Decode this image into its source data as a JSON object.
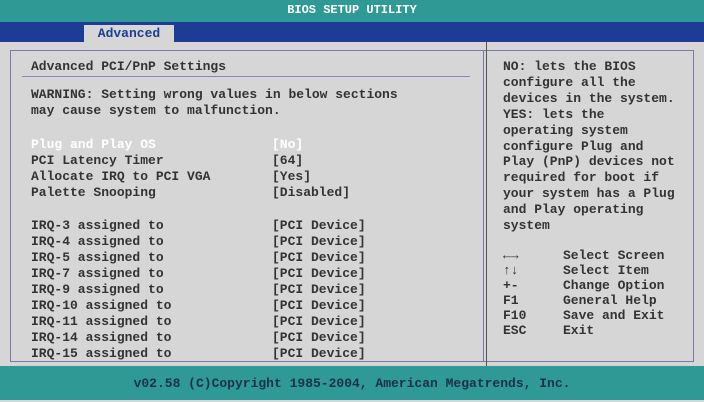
{
  "title": "BIOS SETUP UTILITY",
  "tabs": [
    {
      "label": "Advanced",
      "active": true
    }
  ],
  "section": {
    "title": "Advanced PCI/PnP Settings",
    "warning": "WARNING: Setting wrong values in below sections\nmay cause system to malfunction."
  },
  "settings": [
    {
      "label": "Plug and Play OS",
      "value": "[No]",
      "selected": true
    },
    {
      "label": "PCI Latency Timer",
      "value": "[64]",
      "selected": false
    },
    {
      "label": "Allocate IRQ to PCI VGA",
      "value": "[Yes]",
      "selected": false
    },
    {
      "label": "Palette Snooping",
      "value": "[Disabled]",
      "selected": false
    }
  ],
  "irqs": [
    {
      "label": "IRQ-3 assigned to",
      "value": "[PCI Device]"
    },
    {
      "label": "IRQ-4 assigned to",
      "value": "[PCI Device]"
    },
    {
      "label": "IRQ-5 assigned to",
      "value": "[PCI Device]"
    },
    {
      "label": "IRQ-7 assigned to",
      "value": "[PCI Device]"
    },
    {
      "label": "IRQ-9 assigned to",
      "value": "[PCI Device]"
    },
    {
      "label": "IRQ-10 assigned to",
      "value": "[PCI Device]"
    },
    {
      "label": "IRQ-11 assigned to",
      "value": "[PCI Device]"
    },
    {
      "label": "IRQ-14 assigned to",
      "value": "[PCI Device]"
    },
    {
      "label": "IRQ-15 assigned to",
      "value": "[PCI Device]"
    }
  ],
  "help": {
    "text": "NO: lets the BIOS\nconfigure all the\ndevices in the system.\nYES: lets the\noperating system\nconfigure Plug and\nPlay (PnP) devices not\nrequired for boot if\nyour system has a Plug\nand Play operating\nsystem",
    "keys": [
      {
        "key": "←→",
        "desc": "Select Screen"
      },
      {
        "key": "↑↓",
        "desc": "Select Item"
      },
      {
        "key": "+-",
        "desc": "Change Option"
      },
      {
        "key": "F1",
        "desc": "General Help"
      },
      {
        "key": "F10",
        "desc": "Save and Exit"
      },
      {
        "key": "ESC",
        "desc": "Exit"
      }
    ]
  },
  "footer": "v02.58 (C)Copyright 1985-2004, American Megatrends, Inc.",
  "colors": {
    "title_bar": "#2f9a95",
    "tab_strip": "#1c3c96",
    "panel_bg": "#d6d6d6",
    "selected_text": "#ffffff"
  }
}
